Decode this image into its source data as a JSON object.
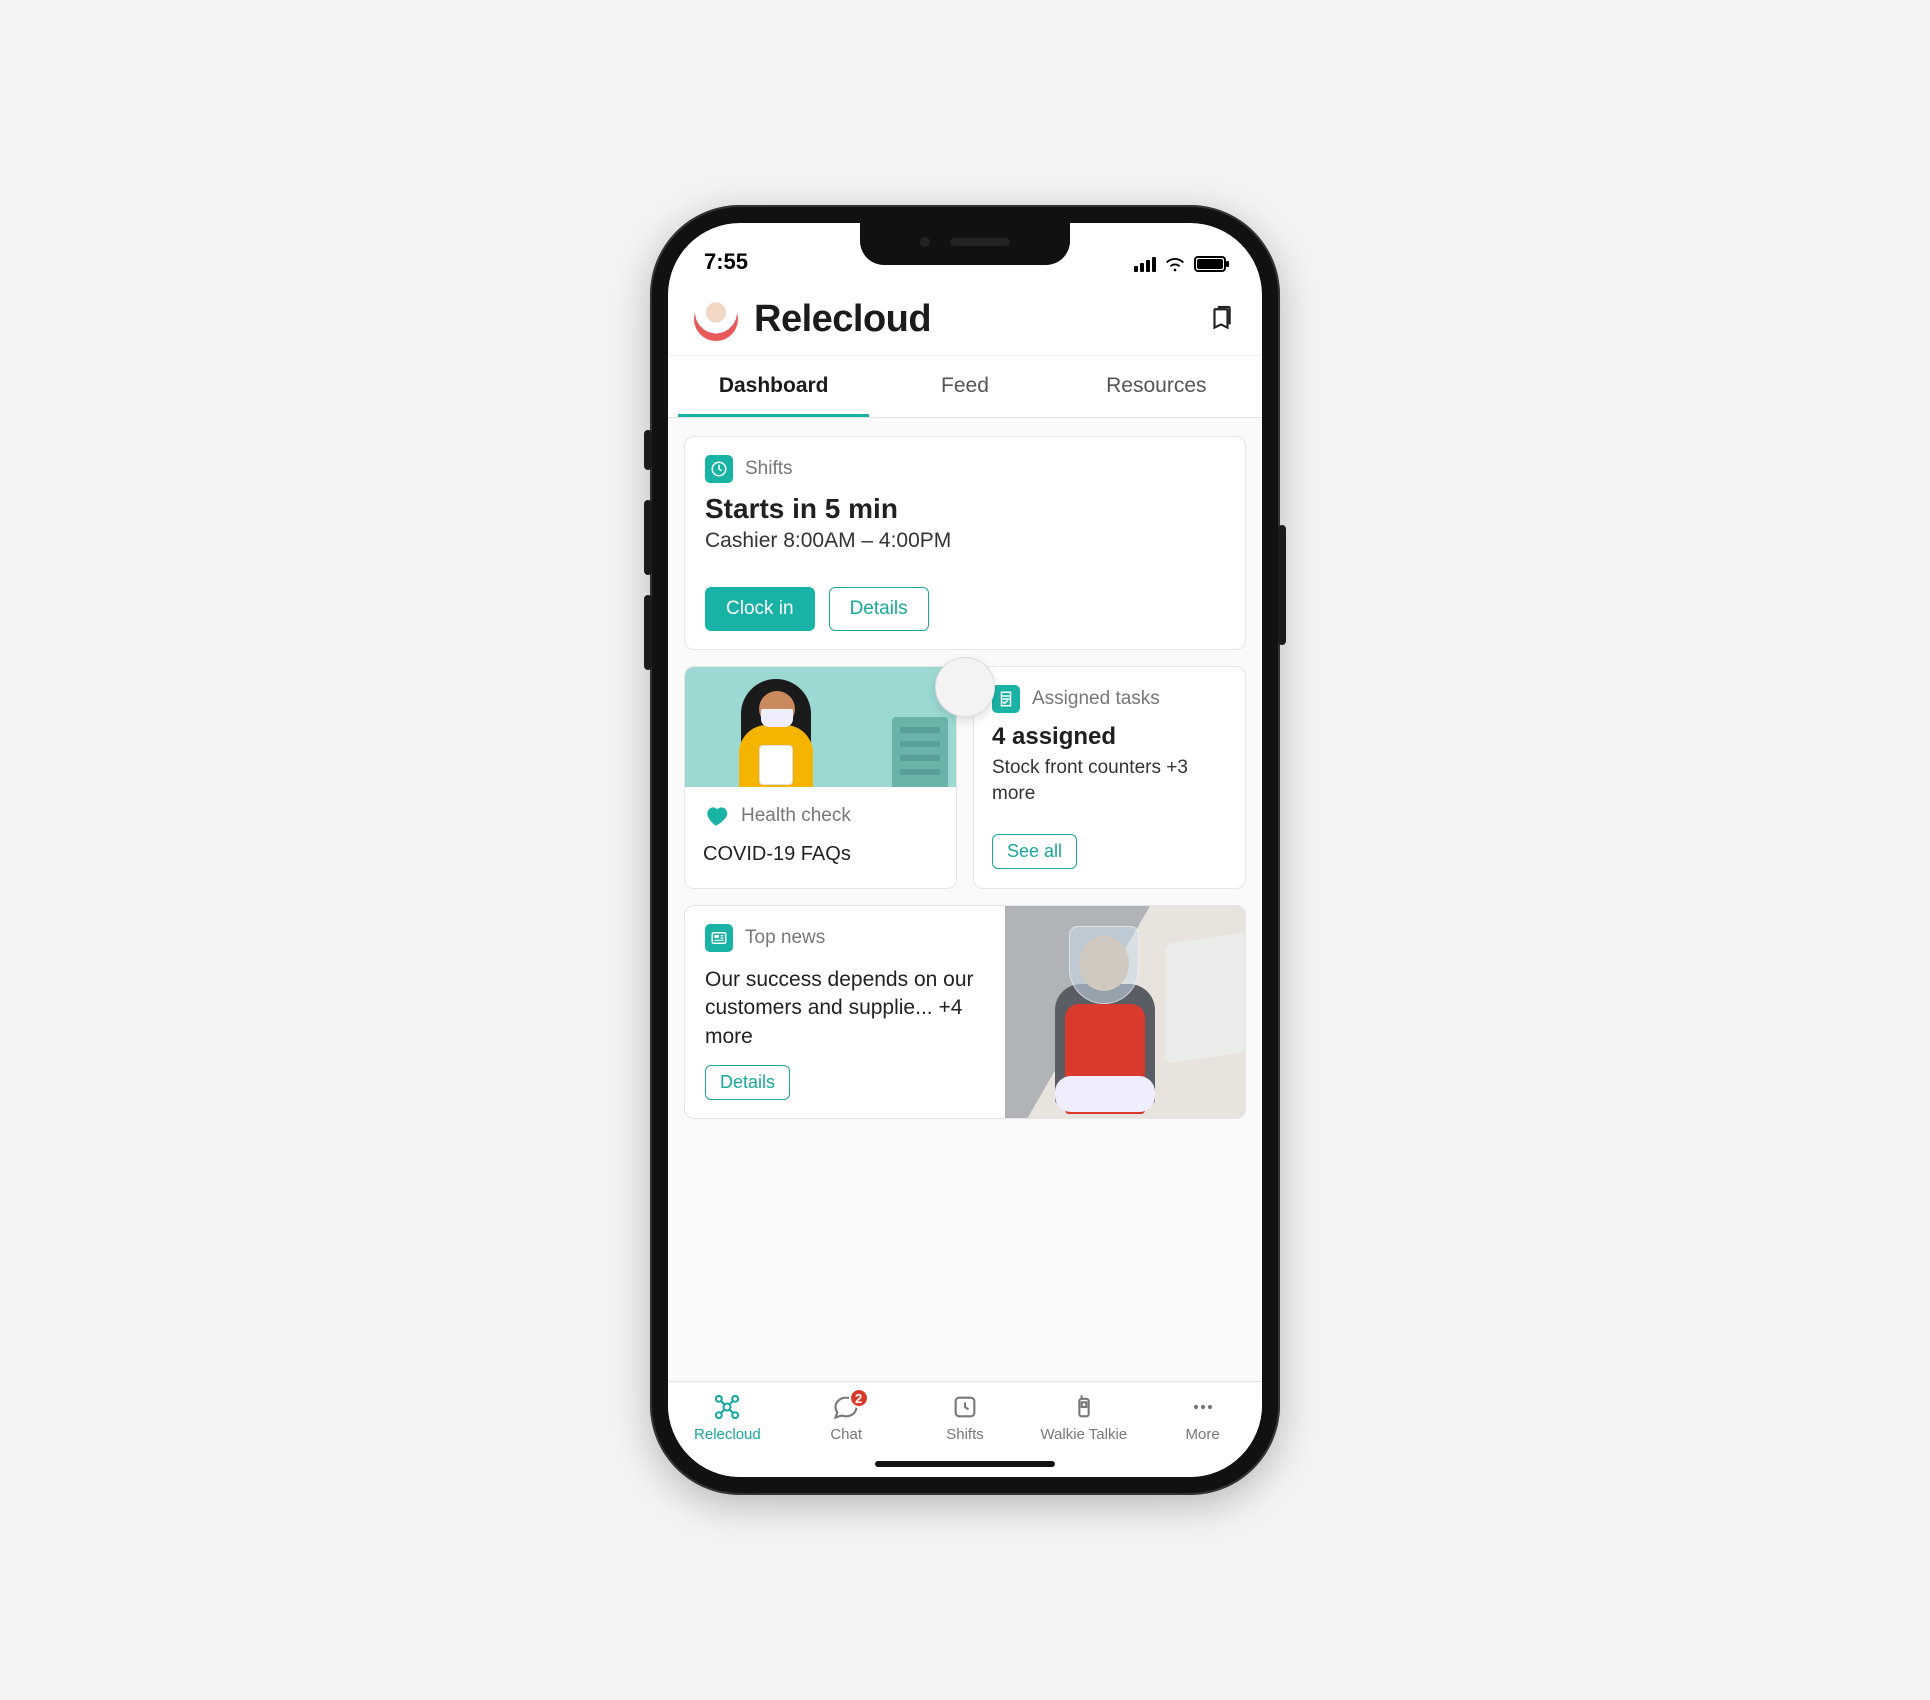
{
  "statusbar": {
    "time": "7:55"
  },
  "header": {
    "title": "Relecloud"
  },
  "tabs": [
    {
      "label": "Dashboard",
      "active": true
    },
    {
      "label": "Feed",
      "active": false
    },
    {
      "label": "Resources",
      "active": false
    }
  ],
  "shifts_card": {
    "icon_label": "Shifts",
    "title": "Starts in 5 min",
    "subtitle": "Cashier 8:00AM – 4:00PM",
    "clock_in_label": "Clock in",
    "details_label": "Details"
  },
  "health_card": {
    "label": "Health check",
    "title": "COVID-19 FAQs"
  },
  "tasks_card": {
    "label": "Assigned tasks",
    "title": "4 assigned",
    "subtitle": "Stock front counters +3 more",
    "see_all_label": "See all"
  },
  "news_card": {
    "label": "Top news",
    "text": "Our success depends on our customers and supplie... +4 more",
    "details_label": "Details"
  },
  "bottom_nav": {
    "items": [
      {
        "label": "Relecloud"
      },
      {
        "label": "Chat",
        "badge": "2"
      },
      {
        "label": "Shifts"
      },
      {
        "label": "Walkie Talkie"
      },
      {
        "label": "More"
      }
    ]
  }
}
